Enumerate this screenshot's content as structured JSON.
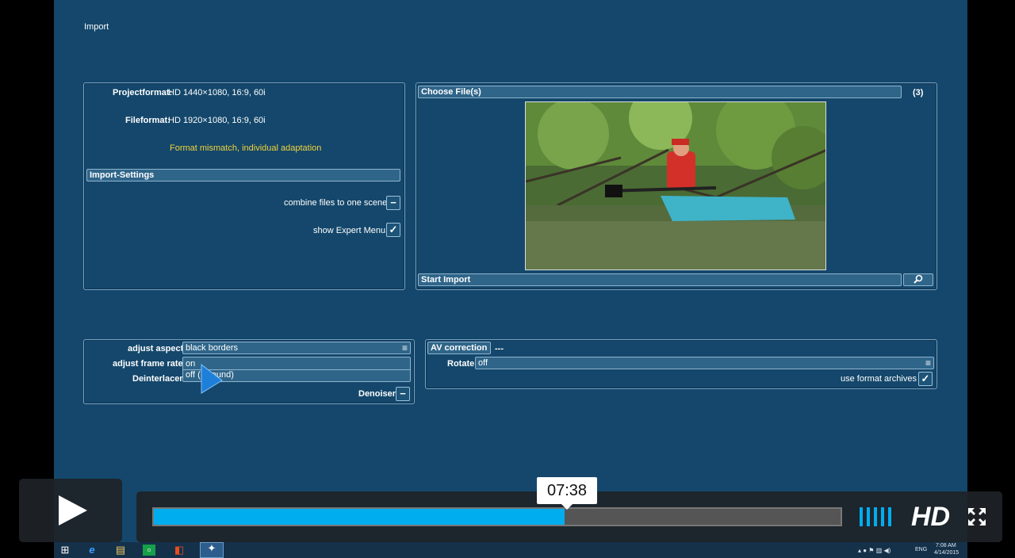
{
  "screen": {
    "title": "Import"
  },
  "project": {
    "projectformat_label": "Projectformat:",
    "projectformat_value": "HD 1440×1080, 16:9, 60i",
    "fileformat_label": "Fileformat:",
    "fileformat_value": "HD 1920×1080, 16:9, 60i",
    "warning": "Format mismatch, individual adaptation",
    "import_settings_label": "Import-Settings",
    "combine_label": "combine files to one scene",
    "combine_state": "−",
    "expert_label": "show Expert Menu",
    "expert_state": "✓"
  },
  "files": {
    "choose_label": "Choose File(s)",
    "count": "(3)",
    "start_label": "Start Import",
    "search_icon": "search-icon"
  },
  "adjust": {
    "aspect_label": "adjust aspect",
    "aspect_value": "black borders",
    "frame_rate_label": "adjust frame rate",
    "frame_rate_value": "on",
    "deinterlacer_label": "Deinterlacer",
    "deinterlacer_value": "off (",
    "deinterlacer_value_tail": "ound)",
    "denoiser_label": "Denoiser",
    "denoiser_state": "−"
  },
  "av": {
    "correction_label": "AV correction",
    "correction_value": "---",
    "rotate_label": "Rotate",
    "rotate_value": "off",
    "archives_label": "use format archives",
    "archives_state": "✓"
  },
  "player": {
    "time": "07:38",
    "progress": 0.598,
    "hd_label": "HD",
    "accent": "#00adef"
  },
  "taskbar": {
    "lang": "ENG",
    "time": "7:08 AM",
    "date": "4/14/2015"
  }
}
